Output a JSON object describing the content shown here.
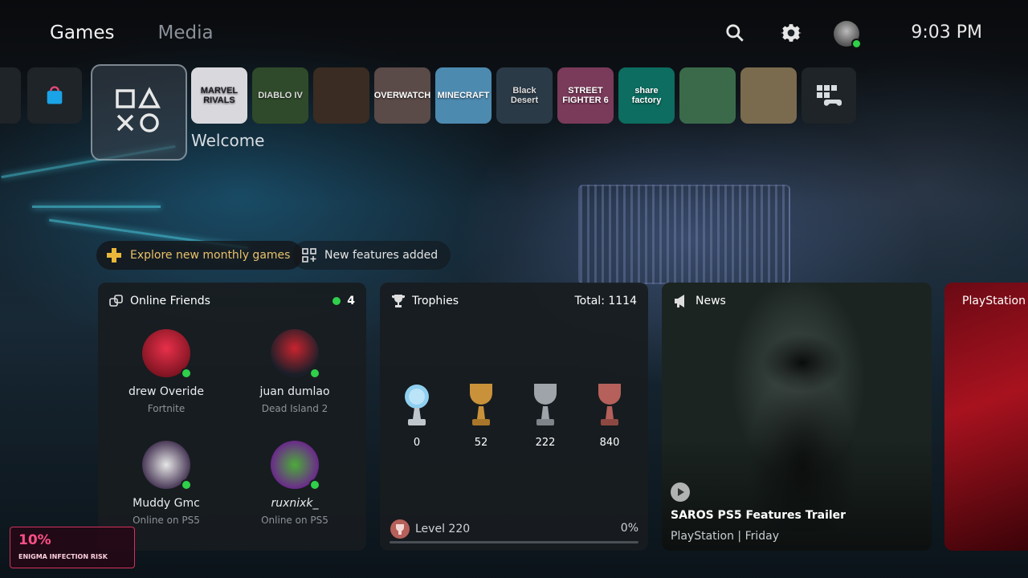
{
  "nav": {
    "tabs": [
      {
        "label": "Games",
        "active": true
      },
      {
        "label": "Media",
        "active": false
      }
    ]
  },
  "topbar": {
    "clock": "9:03 PM"
  },
  "games": {
    "welcome_label": "Welcome",
    "tiles": [
      {
        "label": "MARVEL RIVALS",
        "color": "#d9d9dd",
        "text_color": "#1c1c24"
      },
      {
        "label": "DIABLO IV",
        "color": "#2f4a2a",
        "text_color": "#ddd"
      },
      {
        "label": "",
        "color": "#3a2c22",
        "text_color": "#ddd"
      },
      {
        "label": "OVERWATCH",
        "color": "#5a4a48",
        "text_color": "#fff"
      },
      {
        "label": "MINECRAFT",
        "color": "#4d8ab0",
        "text_color": "#fff"
      },
      {
        "label": "Black Desert",
        "color": "#2b3a47",
        "text_color": "#ddd"
      },
      {
        "label": "STREET FIGHTER 6",
        "color": "#7a3a5a",
        "text_color": "#fff"
      },
      {
        "label": "share factory",
        "color": "#0c6d60",
        "text_color": "#fff"
      },
      {
        "label": "",
        "color": "#3b6a4a",
        "text_color": "#fff"
      },
      {
        "label": "",
        "color": "#7a6a4e",
        "text_color": "#fff"
      }
    ]
  },
  "pills": {
    "plus": "Explore new monthly games",
    "features": "New features added"
  },
  "friends": {
    "title": "Online Friends",
    "count": "4",
    "list": [
      {
        "name": "drew Overide",
        "activity": "Fortnite",
        "color": "#b5162c"
      },
      {
        "name": "juan dumlao",
        "activity": "Dead Island 2",
        "color": "#3b4858"
      },
      {
        "name": "Muddy  Gmc",
        "activity": "Online on PS5",
        "color": "#6c5a78"
      },
      {
        "name": "ruxnixk_",
        "activity": "Online on PS5",
        "color": "#5a3a78"
      }
    ]
  },
  "trophies": {
    "title": "Trophies",
    "total": "Total: 1114",
    "items": [
      {
        "kind": "platinum",
        "count": "0",
        "color": "#8fd0f0"
      },
      {
        "kind": "gold",
        "count": "52",
        "color": "#c9923a"
      },
      {
        "kind": "silver",
        "count": "222",
        "color": "#9ea4aa"
      },
      {
        "kind": "bronze",
        "count": "840",
        "color": "#b5605a"
      }
    ],
    "level": "Level 220",
    "progress": "0%",
    "progress_value": 0
  },
  "news": {
    "title": "News",
    "headline": "SAROS PS5 Features Trailer",
    "meta": "PlayStation  |  Friday"
  },
  "store": {
    "title": "PlayStation Store"
  },
  "overlay": {
    "risk_percent": "10%",
    "risk_label": "ENIGMA INFECTION RISK"
  }
}
